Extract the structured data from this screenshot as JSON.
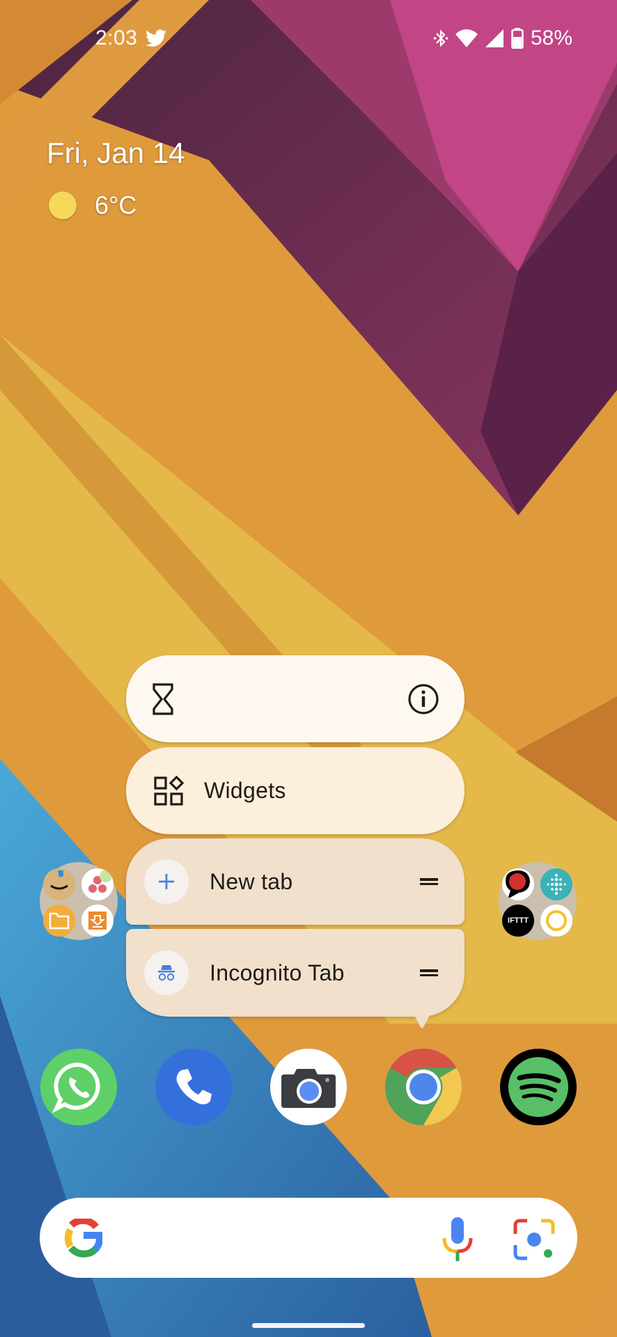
{
  "status_bar": {
    "time": "2:03",
    "notification_icons": [
      "twitter-icon"
    ],
    "system_icons": [
      "bluetooth-icon",
      "wifi-icon",
      "cell-signal-icon",
      "battery-icon"
    ],
    "battery_percent": "58%"
  },
  "glance": {
    "date": "Fri, Jan 14",
    "weather_icon": "sunny-icon",
    "temperature": "6°C"
  },
  "popup_menu": {
    "app": "Chrome",
    "header_icons": [
      "app-timer-hourglass-icon",
      "app-info-icon"
    ],
    "items": [
      {
        "label": "Widgets",
        "icon": "widgets-icon"
      },
      {
        "label": "New tab",
        "icon": "plus-icon",
        "draggable": true
      },
      {
        "label": "Incognito Tab",
        "icon": "incognito-icon",
        "draggable": true
      }
    ]
  },
  "folders": [
    {
      "name": "left-folder",
      "apps": [
        "Amazon Shopping",
        "Cluster app",
        "Files",
        "Downloader"
      ]
    },
    {
      "name": "right-folder",
      "apps": [
        "Speech bubble app",
        "Fitbit",
        "IFTTT",
        "Ring app"
      ]
    }
  ],
  "dock": [
    {
      "app": "WhatsApp",
      "color": "#5fd067"
    },
    {
      "app": "Phone",
      "color": "#3470dc"
    },
    {
      "app": "Camera",
      "color": "#ffffff"
    },
    {
      "app": "Chrome",
      "color": "#ffffff"
    },
    {
      "app": "Spotify",
      "color": "#1ed760"
    }
  ],
  "search_bar": {
    "logo": "G",
    "icons": [
      "google-logo-icon",
      "microphone-icon",
      "google-lens-icon"
    ]
  },
  "colors": {
    "menu_top": "#fef8f1",
    "menu_widgets": "#fcefdb",
    "menu_shortcuts": "#f0e0cc",
    "accent_blue": "#4a7fdc"
  }
}
